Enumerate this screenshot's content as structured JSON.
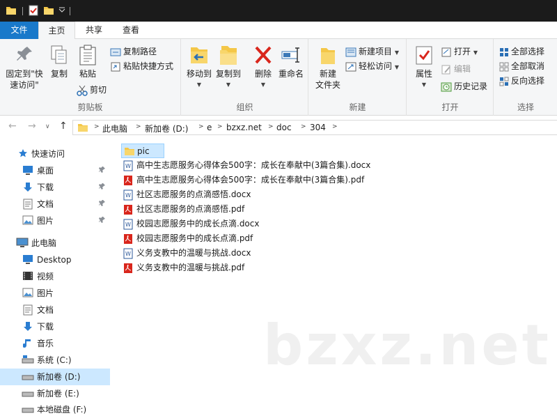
{
  "tabs": {
    "file": "文件",
    "home": "主页",
    "share": "共享",
    "view": "查看"
  },
  "ribbon": {
    "clipboard": {
      "label": "剪贴板",
      "pin": "固定到\"快速访问\"",
      "copy": "复制",
      "paste": "粘贴",
      "copy_path": "复制路径",
      "paste_shortcut": "粘贴快捷方式",
      "cut": "剪切"
    },
    "organize": {
      "label": "组织",
      "move_to": "移动到",
      "copy_to": "复制到",
      "delete": "删除",
      "rename": "重命名"
    },
    "new": {
      "label": "新建",
      "new_folder": "新建\n文件夹",
      "new_item": "新建项目",
      "easy_access": "轻松访问"
    },
    "open": {
      "label": "打开",
      "properties": "属性",
      "open": "打开",
      "edit": "编辑",
      "history": "历史记录"
    },
    "select": {
      "label": "选择",
      "select_all": "全部选择",
      "select_none": "全部取消",
      "invert": "反向选择"
    }
  },
  "address": {
    "crumbs": [
      "此电脑",
      "新加卷 (D:)",
      "e",
      "bzxz.net",
      "doc",
      "304"
    ]
  },
  "sidebar": {
    "items": [
      {
        "label": "快速访问",
        "icon": "star-icon"
      },
      {
        "label": "桌面",
        "icon": "desktop-icon"
      },
      {
        "label": "下载",
        "icon": "download-icon"
      },
      {
        "label": "文档",
        "icon": "document-icon"
      },
      {
        "label": "图片",
        "icon": "picture-icon"
      },
      {
        "label": "此电脑",
        "icon": "computer-icon"
      },
      {
        "label": "Desktop",
        "icon": "desktop-icon"
      },
      {
        "label": "视频",
        "icon": "video-icon"
      },
      {
        "label": "图片",
        "icon": "picture-icon"
      },
      {
        "label": "文档",
        "icon": "document-icon"
      },
      {
        "label": "下载",
        "icon": "download-icon"
      },
      {
        "label": "音乐",
        "icon": "music-icon"
      },
      {
        "label": "系统 (C:)",
        "icon": "drive-icon"
      },
      {
        "label": "新加卷 (D:)",
        "icon": "drive-icon"
      },
      {
        "label": "新加卷 (E:)",
        "icon": "drive-icon"
      },
      {
        "label": "本地磁盘 (F:)",
        "icon": "drive-icon"
      }
    ]
  },
  "files": [
    {
      "name": "pic",
      "type": "folder"
    },
    {
      "name": "高中生志愿服务心得体会500字：成长在奉献中(3篇合集).docx",
      "type": "docx"
    },
    {
      "name": "高中生志愿服务心得体会500字：成长在奉献中(3篇合集).pdf",
      "type": "pdf"
    },
    {
      "name": "社区志愿服务的点滴感悟.docx",
      "type": "docx"
    },
    {
      "name": "社区志愿服务的点滴感悟.pdf",
      "type": "pdf"
    },
    {
      "name": "校园志愿服务中的成长点滴.docx",
      "type": "docx"
    },
    {
      "name": "校园志愿服务中的成长点滴.pdf",
      "type": "pdf"
    },
    {
      "name": "义务支教中的温暖与挑战.docx",
      "type": "docx"
    },
    {
      "name": "义务支教中的温暖与挑战.pdf",
      "type": "pdf"
    }
  ],
  "watermark": "bzxz.net",
  "colors": {
    "file_tab": "#1979ca",
    "selection": "#cce8ff",
    "delete_red": "#d9261c",
    "folder": "#f4c748"
  }
}
